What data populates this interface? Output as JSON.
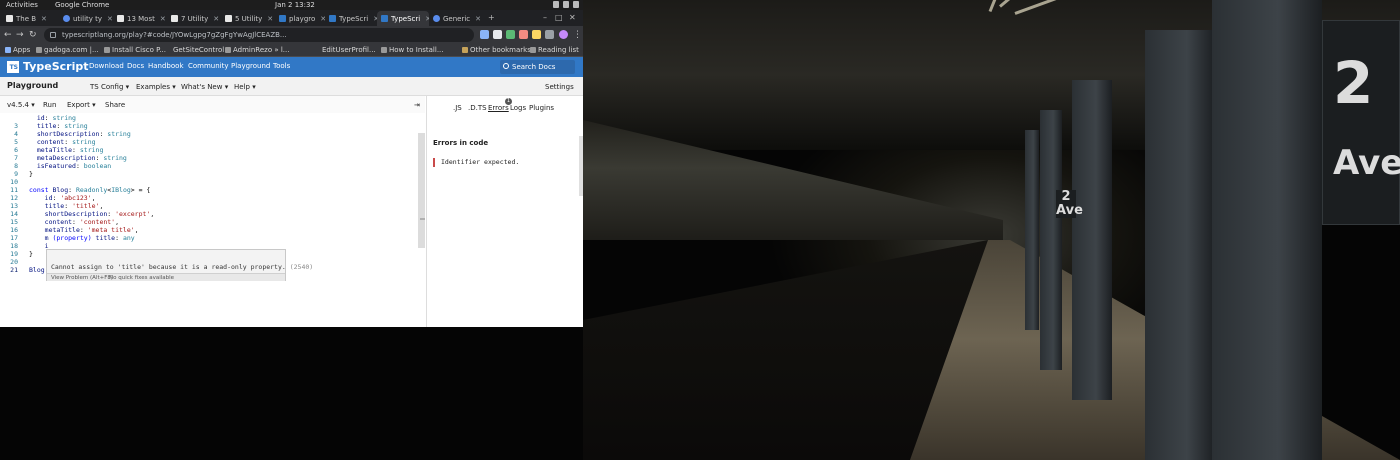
{
  "topbar": {
    "activities": "Activities",
    "app": "Google Chrome",
    "clock": "Jan 2  13:32"
  },
  "tabs": [
    {
      "title": "The B",
      "icon": "dev-icon"
    },
    {
      "title": "utility ty",
      "icon": "google-icon"
    },
    {
      "title": "13 Most",
      "icon": "dev-icon"
    },
    {
      "title": "7 Utility",
      "icon": "dev-icon"
    },
    {
      "title": "5 Utility",
      "icon": "dev-icon"
    },
    {
      "title": "playgro",
      "icon": "ts-icon"
    },
    {
      "title": "TypeScri",
      "icon": "ts-icon"
    },
    {
      "title": "TypeScri",
      "icon": "ts-icon"
    },
    {
      "title": "Generic",
      "icon": "google-icon"
    }
  ],
  "address": {
    "url": "typescriptlang.org/play?#code/JYOwLgpg7gZgFgYwAgJlCEAZB..."
  },
  "bookmarks": [
    {
      "label": "Apps"
    },
    {
      "label": "gadoga.com |..."
    },
    {
      "label": "Install Cisco P..."
    },
    {
      "label": "GetSiteControl"
    },
    {
      "label": "AdminRezo » l..."
    },
    {
      "label": "EditUserProfil..."
    },
    {
      "label": "How to Install..."
    }
  ],
  "bookmarks_right": {
    "other": "Other bookmarks",
    "reading": "Reading list"
  },
  "site": {
    "name": "TypeScript",
    "logo": "TS",
    "nav": [
      "Download",
      "Docs",
      "Handbook",
      "Community",
      "Playground",
      "Tools"
    ],
    "search": "Search Docs"
  },
  "playground": {
    "title": "Playground",
    "menus": [
      "TS Config",
      "Examples",
      "What's New",
      "Help"
    ],
    "settings": "Settings"
  },
  "toolbar": {
    "version": "v4.5.4",
    "run": "Run",
    "export": "Export",
    "share": "Share",
    "collapse": "⇥"
  },
  "editor": {
    "hover_signature": "(property) title: any",
    "hover_message": "Cannot assign to 'title' because it is a read-only property.",
    "hover_code": "(2540)",
    "hover_view_problem": "View Problem (Alt+F8)",
    "hover_no_fix": "No quick fixes available"
  },
  "sidebar": {
    "tabs": [
      ".JS",
      ".D.TS",
      "Errors",
      "Logs",
      "Plugins"
    ],
    "error_count": "1",
    "heading": "Errors in code",
    "error": "Identifier expected."
  },
  "wallpaper": {
    "sign_number": "2",
    "sign_text": "Ave",
    "small_sign": "2 Ave"
  }
}
